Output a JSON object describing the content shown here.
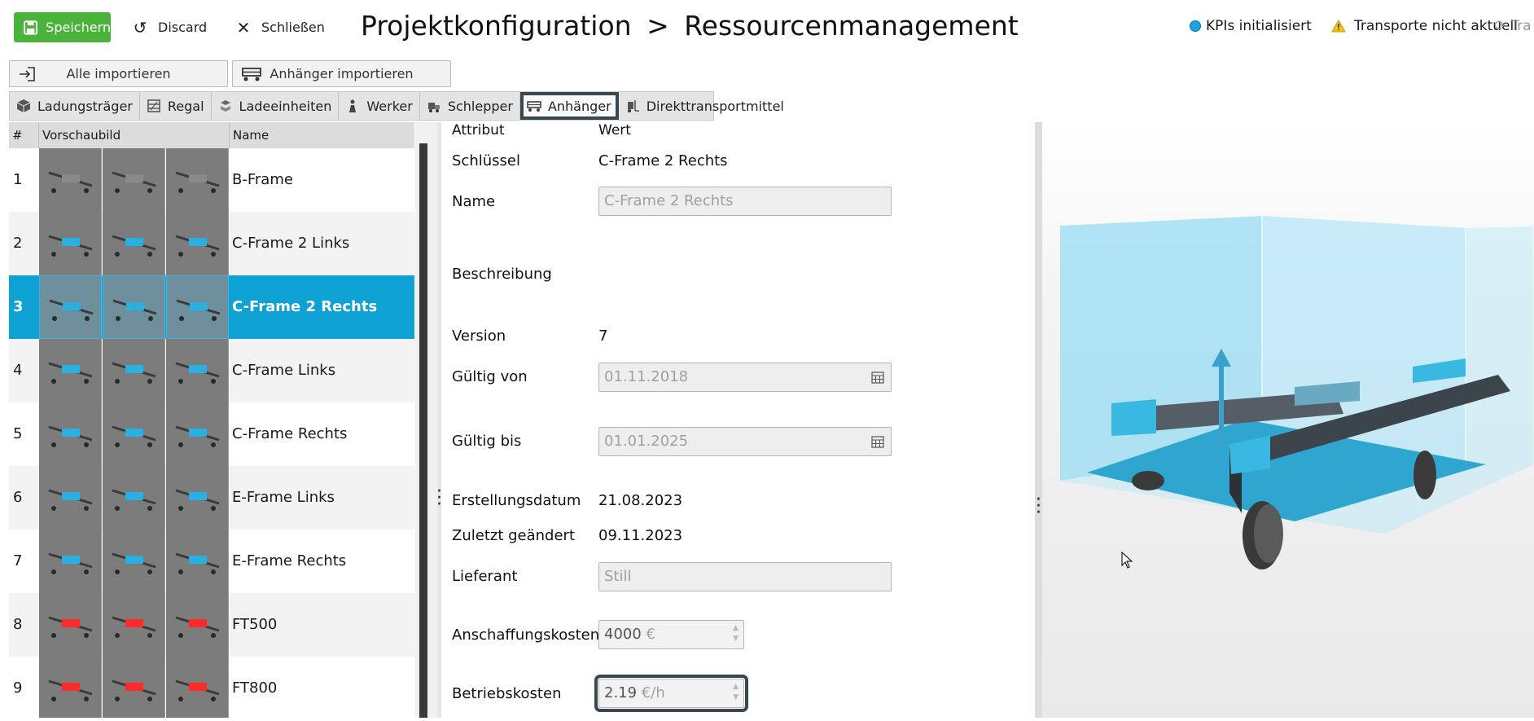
{
  "toolbar": {
    "save_label": "Speichern",
    "discard_label": "Discard",
    "close_label": "Schließen"
  },
  "title": {
    "section": "Projektkonfiguration",
    "separator": ">",
    "page": "Ressourcenmanagement"
  },
  "status": {
    "kpi_label": "KPIs initialisiert",
    "transport_label": "Transporte nicht aktuell",
    "refresh_partial": "Tra"
  },
  "import": {
    "all_label": "Alle importieren",
    "trailer_label": "Anhänger importieren"
  },
  "tabs": [
    {
      "label": "Ladungsträger",
      "icon": "cube-icon"
    },
    {
      "label": "Regal",
      "icon": "shelf-icon"
    },
    {
      "label": "Ladeeinheiten",
      "icon": "boxes-icon"
    },
    {
      "label": "Werker",
      "icon": "worker-icon"
    },
    {
      "label": "Schlepper",
      "icon": "tugger-icon"
    },
    {
      "label": "Anhänger",
      "icon": "trailer-icon",
      "active": true
    },
    {
      "label": "Direkttransportmittel",
      "icon": "forklift-icon"
    }
  ],
  "table": {
    "headers": {
      "num": "#",
      "preview": "Vorschaubild",
      "name": "Name"
    },
    "rows": [
      {
        "num": "1",
        "name": "B-Frame"
      },
      {
        "num": "2",
        "name": "C-Frame 2 Links"
      },
      {
        "num": "3",
        "name": "C-Frame 2 Rechts",
        "selected": true
      },
      {
        "num": "4",
        "name": "C-Frame Links"
      },
      {
        "num": "5",
        "name": "C-Frame Rechts"
      },
      {
        "num": "6",
        "name": "E-Frame Links"
      },
      {
        "num": "7",
        "name": "E-Frame Rechts"
      },
      {
        "num": "8",
        "name": "FT500"
      },
      {
        "num": "9",
        "name": "FT800"
      }
    ]
  },
  "form": {
    "header_attr": "Attribut",
    "header_value": "Wert",
    "key_label": "Schlüssel",
    "key_value": "C-Frame 2 Rechts",
    "name_label": "Name",
    "name_value": "C-Frame 2 Rechts",
    "desc_label": "Beschreibung",
    "version_label": "Version",
    "version_value": "7",
    "valid_from_label": "Gültig von",
    "valid_from_value": "01.11.2018",
    "valid_to_label": "Gültig bis",
    "valid_to_value": "01.01.2025",
    "created_label": "Erstellungsdatum",
    "created_value": "21.08.2023",
    "modified_label": "Zuletzt geändert",
    "modified_value": "09.11.2023",
    "supplier_label": "Lieferant",
    "supplier_value": "Still",
    "acq_label": "Anschaffungskosten",
    "acq_value": "4000",
    "acq_unit": "€",
    "op_label": "Betriebskosten",
    "op_value": "2.19",
    "op_unit": "€/h"
  },
  "colors": {
    "save_green": "#4ab43a",
    "selection_blue": "#0ea2d4",
    "focus_border": "#39474f"
  }
}
